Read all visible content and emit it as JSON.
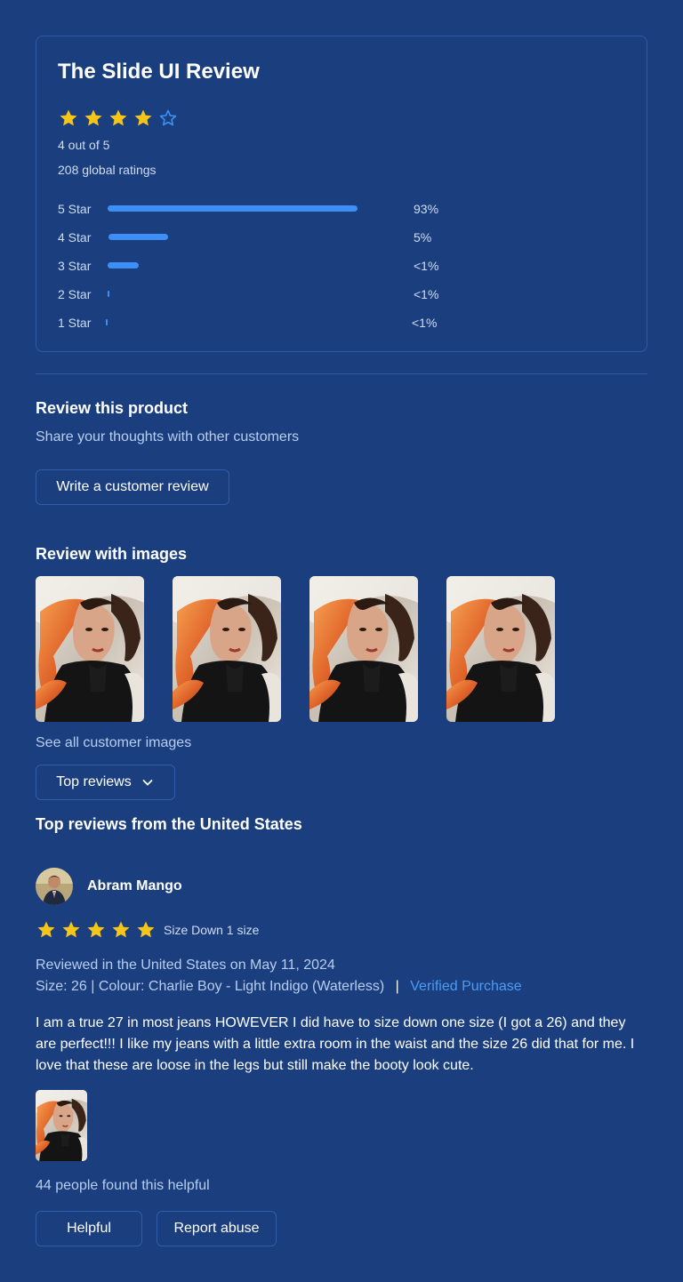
{
  "summary": {
    "title": "The Slide UI Review",
    "rating_stars": 4,
    "rating_text": "4 out of 5",
    "global_ratings": "208  global ratings",
    "distribution": [
      {
        "label": "5 Star",
        "fraction": 0.97,
        "pct": "93%"
      },
      {
        "label": "4 Star",
        "fraction": 0.23,
        "pct": "5%"
      },
      {
        "label": "3 Star",
        "fraction": 0.12,
        "pct": "<1%"
      },
      {
        "label": "2 Star",
        "fraction": 0.008,
        "pct": "<1%"
      },
      {
        "label": "1 Star",
        "fraction": 0.008,
        "pct": "<1%"
      }
    ]
  },
  "review_product": {
    "heading": "Review this product",
    "subtext": "Share your thoughts with other customers",
    "button_label": "Write a customer review"
  },
  "images_section": {
    "heading": "Review with images",
    "see_all": "See all customer images"
  },
  "sort": {
    "selected": "Top reviews",
    "icon": "chevron-down-icon"
  },
  "reviews_heading": "Top reviews from the United States",
  "review": {
    "author": "Abram Mango",
    "stars": 5,
    "size_note": "Size Down 1 size",
    "reviewed_line": "Reviewed in the United States on May 11, 2024",
    "size": "Size: 26",
    "colour": "Colour: Charlie Boy - Light Indigo (Waterless)",
    "separator": "|",
    "verified": "Verified Purchase",
    "body": "I am a true 27 in most jeans HOWEVER I did have to size down one size (I got a 26) and they are perfect!!! I like my jeans with a little extra room in the waist and the size 26 did that for me. I love that these are loose in the legs but still make the booty look cute.",
    "helpful_count": "44 people found this helpful",
    "helpful_label": "Helpful",
    "report_label": "Report abuse"
  },
  "colors": {
    "background": "#1b3f7e",
    "star": "#f5c518",
    "star_empty": "#3d8ff5",
    "bar": "#3d8ff5",
    "link": "#4a9cf7"
  }
}
